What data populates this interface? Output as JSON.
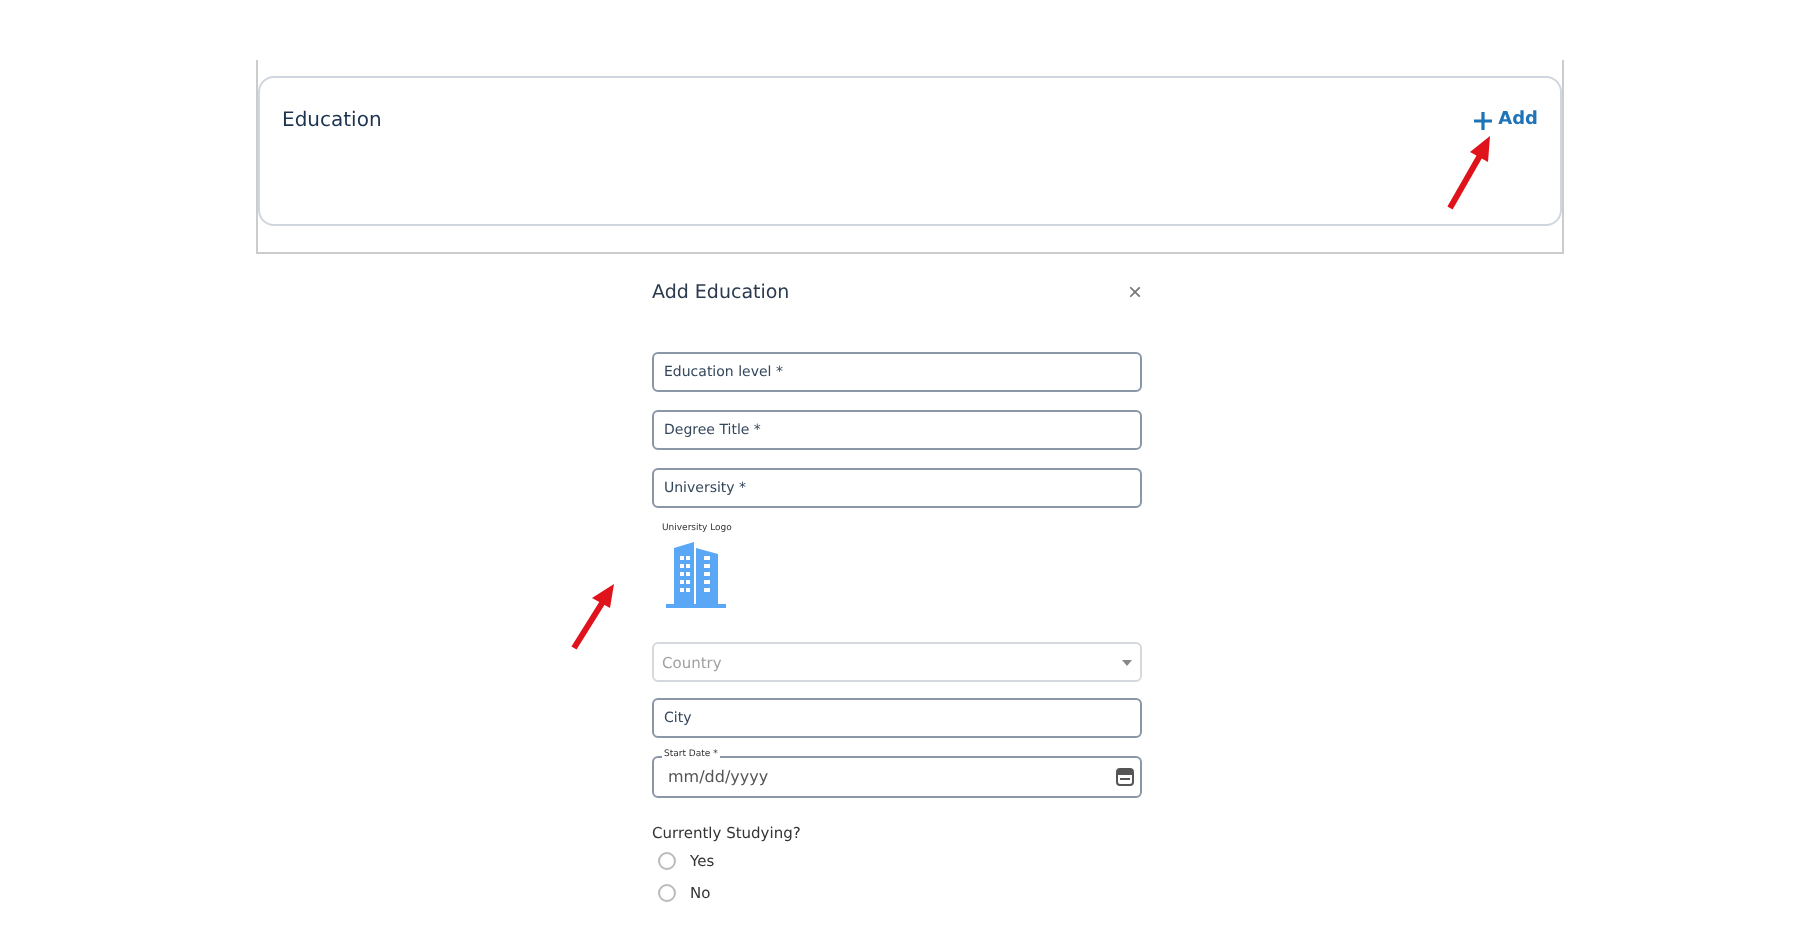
{
  "section": {
    "title": "Education",
    "add_label": "Add"
  },
  "dialog": {
    "title": "Add Education",
    "close": "×",
    "fields": [
      {
        "kind": "text",
        "placeholder": "Education level *"
      },
      {
        "kind": "text",
        "placeholder": "Degree Title *"
      },
      {
        "kind": "text",
        "placeholder": "University *"
      }
    ],
    "logo_label": "University Logo",
    "location_fields": [
      {
        "kind": "select",
        "placeholder": "Country"
      },
      {
        "kind": "text",
        "placeholder": "City"
      }
    ],
    "start_date": {
      "label": "Start Date *",
      "placeholder": "mm/dd/yyyy"
    },
    "question": "Currently Studying?",
    "options": [
      {
        "label": "Yes",
        "selected": false
      },
      {
        "label": "No",
        "selected": false
      }
    ]
  }
}
